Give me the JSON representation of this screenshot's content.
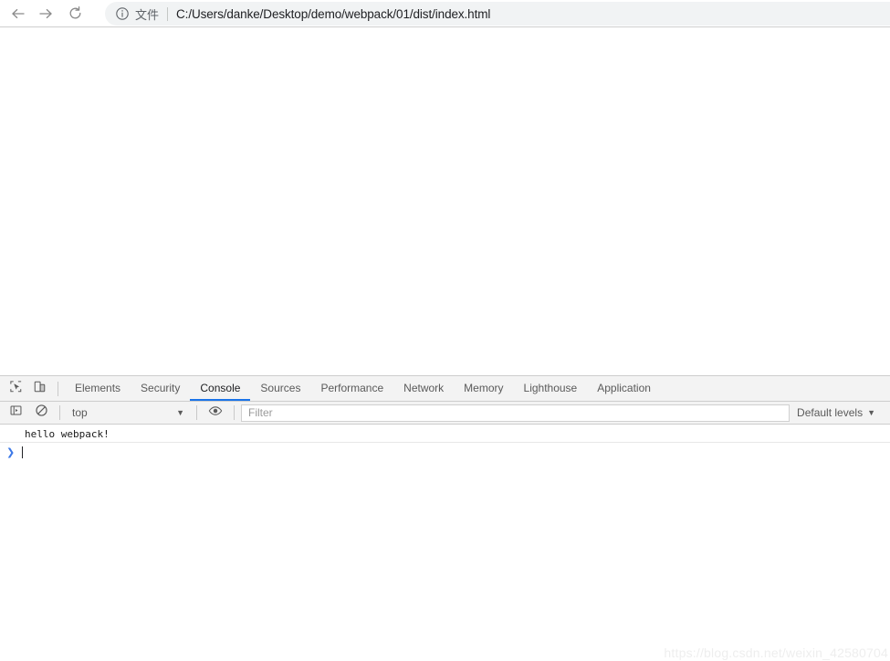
{
  "browser": {
    "toolbar": {
      "back_icon": "arrow-left-icon",
      "forward_icon": "arrow-right-icon",
      "reload_icon": "reload-icon",
      "info_icon": "info-circle-icon"
    },
    "omnibox": {
      "scheme_label": "文件",
      "url": "C:/Users/danke/Desktop/demo/webpack/01/dist/index.html"
    }
  },
  "devtools": {
    "toolbar_icons": {
      "inspect_element": "inspect-element-icon",
      "device_toolbar": "device-toolbar-icon",
      "console_sidebar": "console-sidebar-icon",
      "clear_console": "clear-console-icon",
      "eye": "eye-icon"
    },
    "tabs": [
      {
        "label": "Elements",
        "active": false
      },
      {
        "label": "Security",
        "active": false
      },
      {
        "label": "Console",
        "active": true
      },
      {
        "label": "Sources",
        "active": false
      },
      {
        "label": "Performance",
        "active": false
      },
      {
        "label": "Network",
        "active": false
      },
      {
        "label": "Memory",
        "active": false
      },
      {
        "label": "Lighthouse",
        "active": false
      },
      {
        "label": "Application",
        "active": false
      }
    ],
    "console": {
      "context_value": "top",
      "context_caret": "▼",
      "filter_placeholder": "Filter",
      "filter_value": "",
      "log_level_label": "Default levels",
      "log_level_caret": "▼",
      "messages": [
        {
          "text": "hello webpack!"
        }
      ],
      "prompt_arrow": "❯"
    }
  },
  "watermark": {
    "text": "https://blog.csdn.net/weixin_42580704"
  },
  "colors": {
    "accent_blue": "#1a73e8",
    "prompt_blue": "#3b78e7",
    "toolbar_bg": "#f3f3f3",
    "omnibox_bg": "#f1f3f4"
  }
}
